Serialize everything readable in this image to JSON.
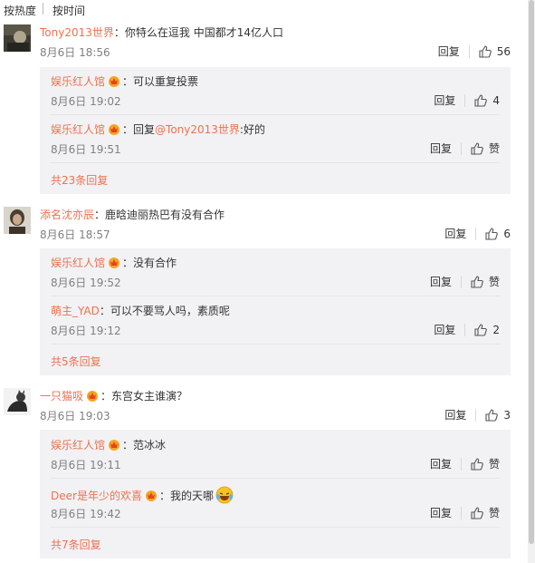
{
  "sort": {
    "hot": "按热度",
    "time": "按时间"
  },
  "colors": {
    "name": "#eb7350",
    "panel": "#f2f2f5"
  },
  "icons": {
    "like": "thumbs-up-icon",
    "badge": "vip-crown-badge-icon",
    "emoji": "laughing-tears-emoji"
  },
  "threads": [
    {
      "name": "Tony2013世界",
      "text": "：你特么在逗我 中国都才14亿人口",
      "time": "8月6日 18:56",
      "reply": "回复",
      "likes": "56",
      "replies": [
        {
          "name": "娱乐红人馆",
          "text": "：可以重复投票",
          "time": "8月6日 19:02",
          "reply": "回复",
          "likes": "4"
        },
        {
          "name": "娱乐红人馆",
          "text_prefix": "：回复",
          "mention": "@Tony2013世界",
          "text": ":好的",
          "time": "8月6日 19:51",
          "reply": "回复",
          "likes": "赞"
        }
      ],
      "more": "共23条回复"
    },
    {
      "name": "添名沈亦辰",
      "text": "：鹿晗迪丽热巴有没有合作",
      "time": "8月6日 18:57",
      "reply": "回复",
      "likes": "6",
      "replies": [
        {
          "name": "娱乐红人馆",
          "text": "：没有合作",
          "time": "8月6日 19:52",
          "reply": "回复",
          "likes": "赞"
        },
        {
          "name": "萌主_YAD",
          "text": "：可以不要骂人吗，素质呢",
          "time": "8月6日 19:12",
          "reply": "回复",
          "likes": "2"
        }
      ],
      "more": "共5条回复"
    },
    {
      "name": "一只猫吸",
      "text": "：东宫女主谁演？",
      "time": "8月6日 19:03",
      "reply": "回复",
      "likes": "3",
      "replies": [
        {
          "name": "娱乐红人馆",
          "text": "：范冰冰",
          "time": "8月6日 19:11",
          "reply": "回复",
          "likes": "赞"
        },
        {
          "name": "Deer是年少的欢喜",
          "text": "：我的天哪",
          "time": "8月6日 19:42",
          "reply": "回复",
          "likes": "赞"
        }
      ],
      "more": "共7条回复"
    }
  ]
}
